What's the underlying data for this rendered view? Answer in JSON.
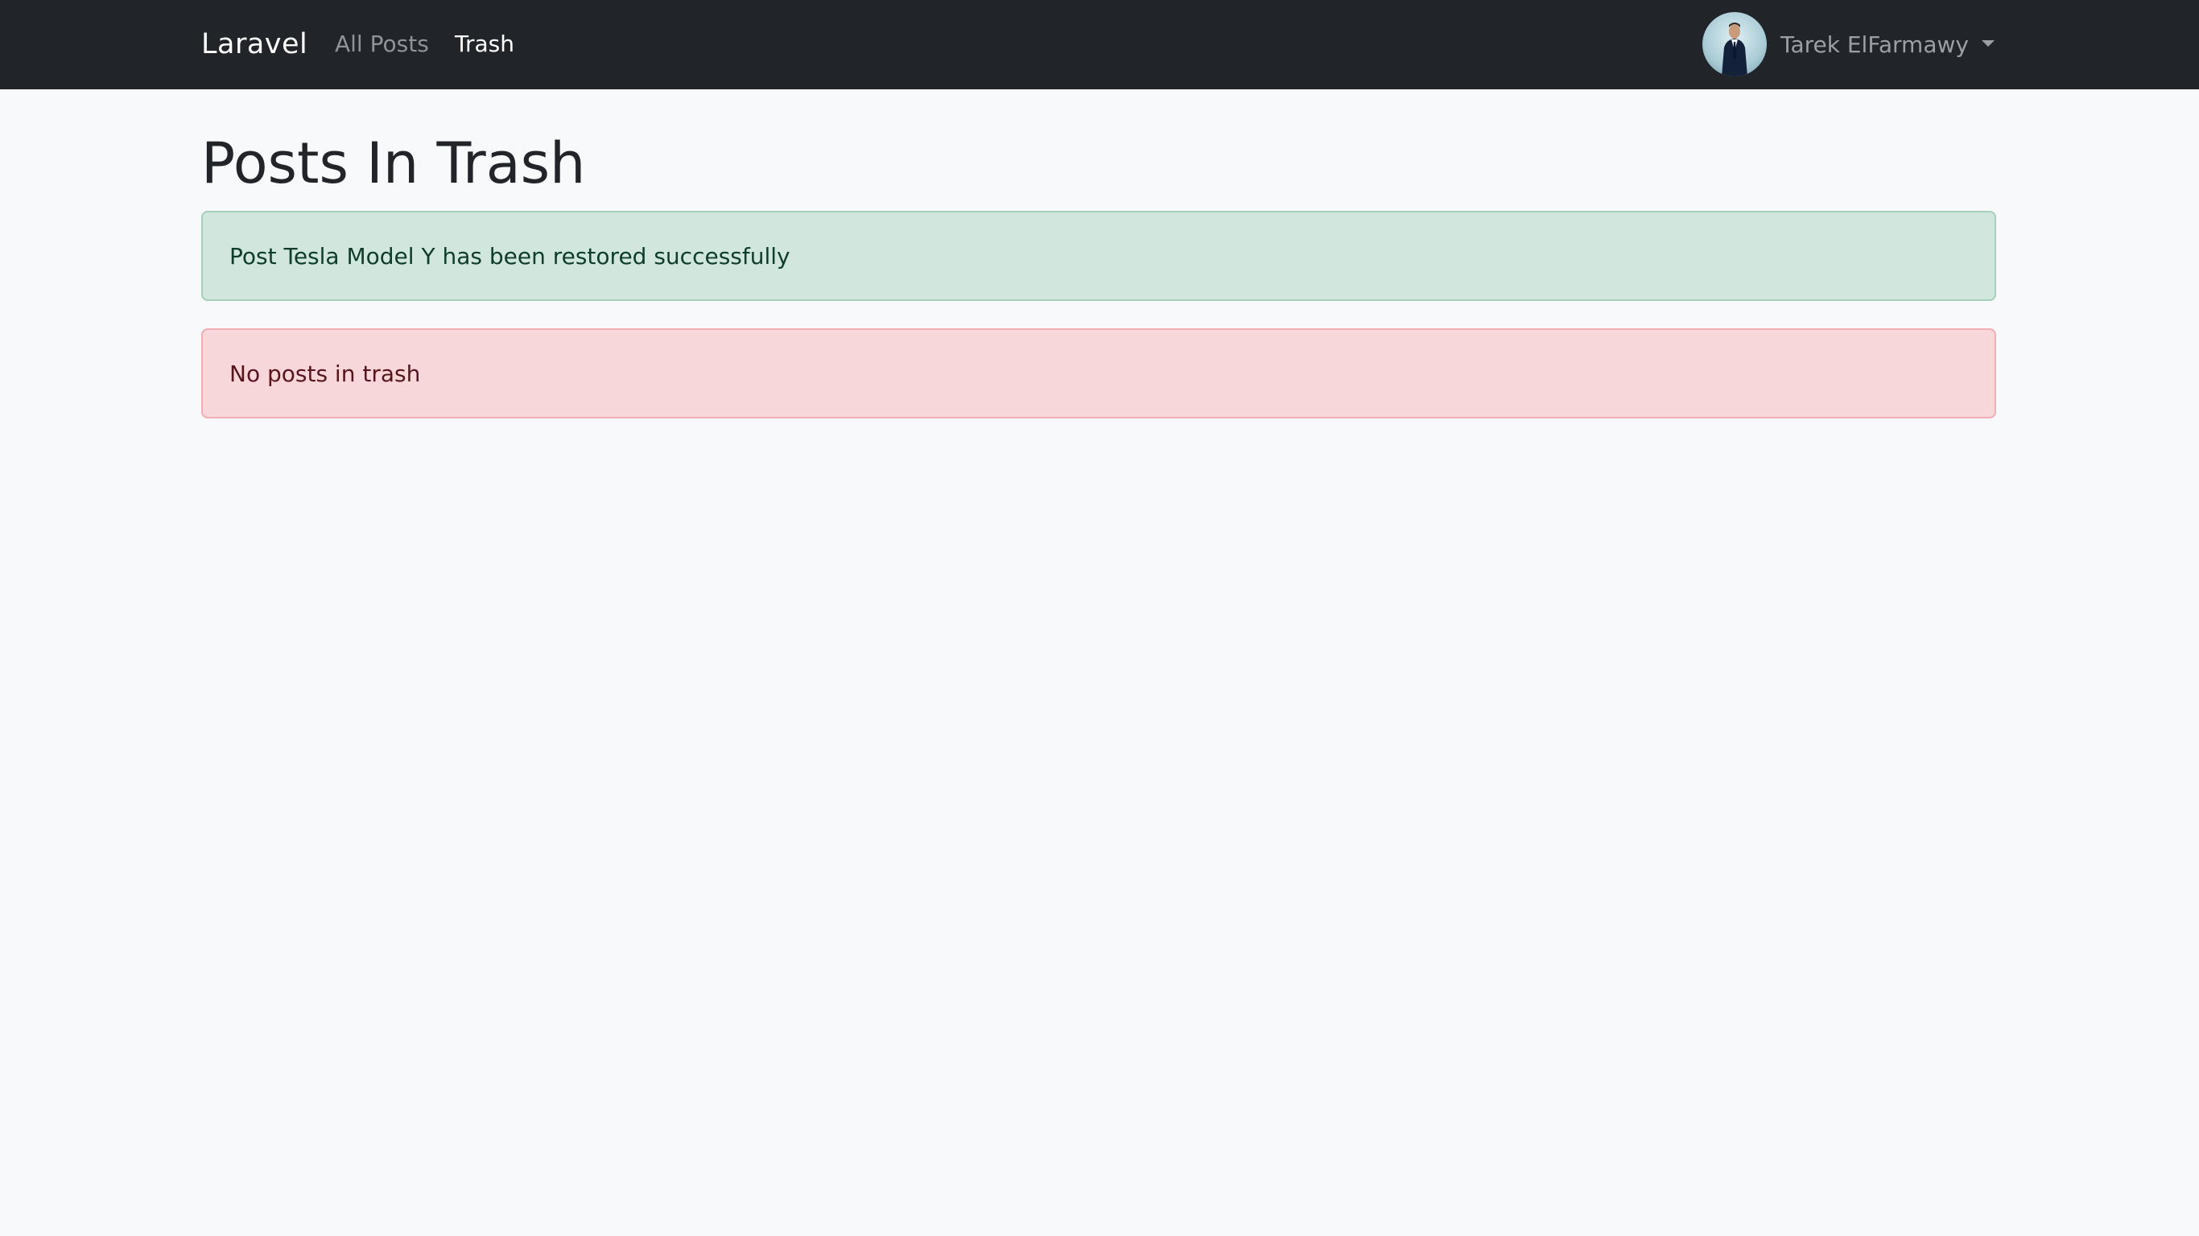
{
  "navbar": {
    "brand": "Laravel",
    "links": [
      {
        "label": "All Posts",
        "active": false
      },
      {
        "label": "Trash",
        "active": true
      }
    ],
    "user": {
      "name": "Tarek ElFarmawy",
      "avatar_icon": "user-avatar-photo"
    }
  },
  "page": {
    "title": "Posts In Trash"
  },
  "alerts": {
    "success": "Post Tesla Model Y has been restored successfully",
    "danger": "No posts in trash"
  },
  "colors": {
    "navbar_bg": "#212529",
    "page_bg": "#f8f9fb",
    "success_bg": "#d1e7dd",
    "danger_bg": "#f8d7da"
  }
}
